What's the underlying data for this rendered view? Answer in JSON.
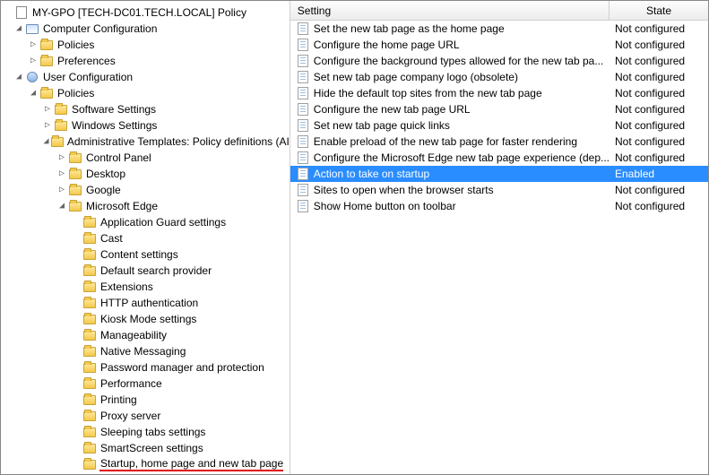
{
  "root": {
    "title": "MY-GPO [TECH-DC01.TECH.LOCAL] Policy"
  },
  "tree": {
    "computer_config": "Computer Configuration",
    "cc_policies": "Policies",
    "cc_preferences": "Preferences",
    "user_config": "User Configuration",
    "uc_policies": "Policies",
    "uc_software": "Software Settings",
    "uc_windows": "Windows Settings",
    "uc_admtpl": "Administrative Templates: Policy definitions (AI",
    "at_controlpanel": "Control Panel",
    "at_desktop": "Desktop",
    "at_google": "Google",
    "at_edge": "Microsoft Edge",
    "edge": {
      "appguard": "Application Guard settings",
      "cast": "Cast",
      "content": "Content settings",
      "defsearch": "Default search provider",
      "ext": "Extensions",
      "httpauth": "HTTP authentication",
      "kiosk": "Kiosk Mode settings",
      "manage": "Manageability",
      "nativem": "Native Messaging",
      "passmgr": "Password manager and protection",
      "perf": "Performance",
      "print": "Printing",
      "proxy": "Proxy server",
      "sleep": "Sleeping tabs settings",
      "smartscreen": "SmartScreen settings",
      "startup": "Startup, home page and new tab page"
    }
  },
  "grid": {
    "header_setting": "Setting",
    "header_state": "State",
    "rows": [
      {
        "label": "Set the new tab page as the home page",
        "state": "Not configured",
        "selected": false
      },
      {
        "label": "Configure the home page URL",
        "state": "Not configured",
        "selected": false
      },
      {
        "label": "Configure the background types allowed for the new tab pa...",
        "state": "Not configured",
        "selected": false
      },
      {
        "label": "Set new tab page company logo (obsolete)",
        "state": "Not configured",
        "selected": false
      },
      {
        "label": "Hide the default top sites from the new tab page",
        "state": "Not configured",
        "selected": false
      },
      {
        "label": "Configure the new tab page URL",
        "state": "Not configured",
        "selected": false
      },
      {
        "label": "Set new tab page quick links",
        "state": "Not configured",
        "selected": false
      },
      {
        "label": "Enable preload of the new tab page for faster rendering",
        "state": "Not configured",
        "selected": false
      },
      {
        "label": "Configure the Microsoft Edge new tab page experience (dep...",
        "state": "Not configured",
        "selected": false
      },
      {
        "label": "Action to take on startup",
        "state": "Enabled",
        "selected": true
      },
      {
        "label": "Sites to open when the browser starts",
        "state": "Not configured",
        "selected": false
      },
      {
        "label": "Show Home button on toolbar",
        "state": "Not configured",
        "selected": false
      }
    ]
  }
}
